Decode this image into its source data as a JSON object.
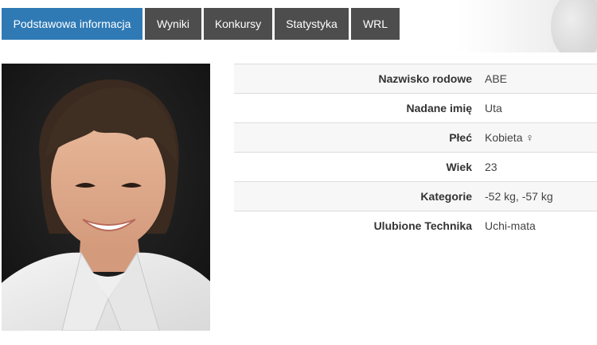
{
  "tabs": [
    {
      "label": "Podstawowa informacja",
      "active": true
    },
    {
      "label": "Wyniki",
      "active": false
    },
    {
      "label": "Konkursy",
      "active": false
    },
    {
      "label": "Statystyka",
      "active": false
    },
    {
      "label": "WRL",
      "active": false
    }
  ],
  "photo": {
    "icon": "athlete-portrait"
  },
  "profile": {
    "rows": [
      {
        "label": "Nazwisko rodowe",
        "value": "ABE"
      },
      {
        "label": "Nadane imię",
        "value": "Uta"
      },
      {
        "label": "Płeć",
        "value": "Kobieta ♀"
      },
      {
        "label": "Wiek",
        "value": "23"
      },
      {
        "label": "Kategorie",
        "value": "-52 kg, -57 kg"
      },
      {
        "label": "Ulubione Technika",
        "value": "Uchi-mata"
      }
    ]
  },
  "colors": {
    "active_tab": "#2f7ab5",
    "inactive_tab": "#4d4d4d",
    "row_stripe": "#f7f7f7"
  }
}
